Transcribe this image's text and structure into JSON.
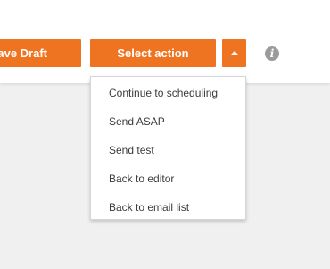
{
  "toolbar": {
    "save_draft_label": "ave Draft",
    "select_action_label": "Select action",
    "caret_icon": "caret-up-icon",
    "info_icon": "info-icon",
    "info_glyph": "i",
    "accent_color": "#ef7422"
  },
  "dropdown": {
    "items": [
      {
        "label": "Continue to scheduling"
      },
      {
        "label": "Send ASAP"
      },
      {
        "label": "Send test"
      },
      {
        "label": "Back to editor"
      },
      {
        "label": "Back to email list"
      }
    ]
  }
}
